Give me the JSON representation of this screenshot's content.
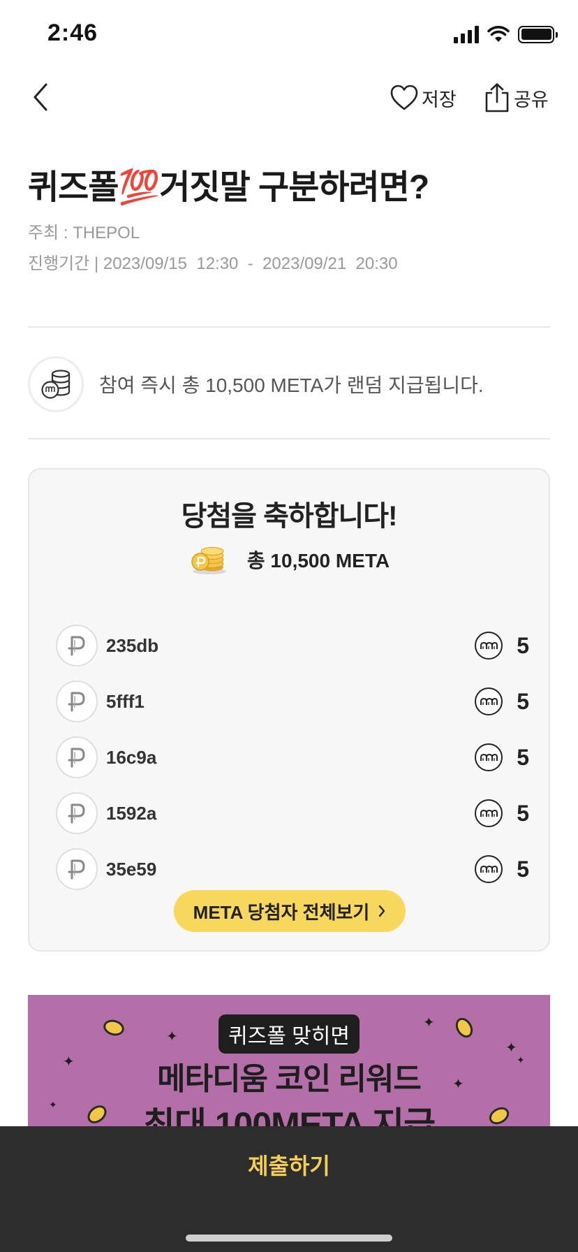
{
  "status_bar": {
    "time": "2:46"
  },
  "nav": {
    "save_label": "저장",
    "share_label": "공유"
  },
  "event": {
    "title": "퀴즈폴💯거짓말 구분하려면?",
    "host": "주최 : THEPOL",
    "period": "진행기간 | 2023/09/15  12:30  -  2023/09/21  20:30"
  },
  "reward": {
    "text": "참여 즉시 총 10,500 META가 랜덤 지급됩니다."
  },
  "winners": {
    "title": "당첨을 축하합니다!",
    "total": "총 10,500 META",
    "items": [
      {
        "id": "235db",
        "amount": "5"
      },
      {
        "id": "5fff1",
        "amount": "5"
      },
      {
        "id": "16c9a",
        "amount": "5"
      },
      {
        "id": "1592a",
        "amount": "5"
      },
      {
        "id": "35e59",
        "amount": "5"
      }
    ],
    "view_all_label": "META 당첨자 전체보기"
  },
  "banner": {
    "pill": "퀴즈폴 맞히면",
    "line1": "메타디움 코인 리워드",
    "line2": "최대 100META 지급"
  },
  "bottom": {
    "submit_label": "제출하기"
  },
  "colors": {
    "accent": "#f7d75c",
    "submit_text": "#f3cf57",
    "bottom_bar": "#2d2d2d",
    "banner_bg": "#b46fa8"
  }
}
